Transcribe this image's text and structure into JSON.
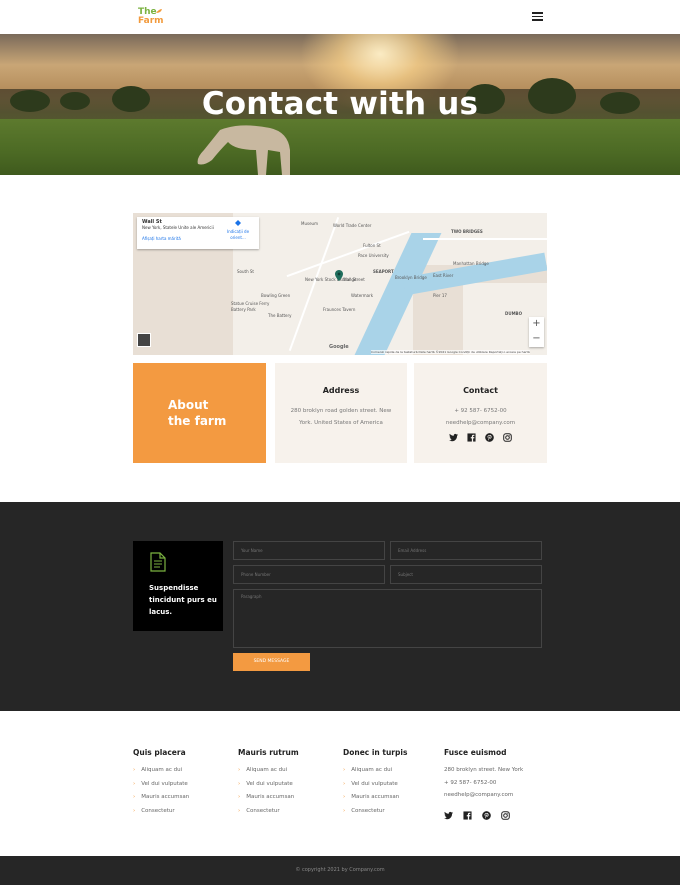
{
  "header": {
    "logo_line1": "The",
    "logo_line2": "Farm"
  },
  "hero": {
    "title": "Contact with us"
  },
  "map": {
    "card_title": "Wall St",
    "card_address": "New York, Statele Unite ale Americii",
    "card_link": "Afișați harta mărită",
    "directions_label": "Indicații de orient...",
    "labels": [
      "Museum",
      "World Trade Center",
      "Fulton St",
      "Pace University",
      "SEAPORT",
      "TWO BRIDGES",
      "Manhattan Bridge",
      "Brooklyn Bridge",
      "East River",
      "Wall Street",
      "New York Stock Exchange",
      "Bowling Green",
      "The Battery",
      "Statue Cruise Ferry",
      "Battery Park",
      "DUMBO",
      "South St",
      "Fraunces Tavern",
      "Watermark",
      "Pier 17"
    ],
    "zoom_in": "+",
    "zoom_out": "−",
    "google": "Google",
    "footer": "Comenzi rapide de la tastatură   Date hartă ©2021 Google   Condiții de utilizare   Raportați o eroare pe hartă"
  },
  "about": {
    "line1": "About",
    "line2": "the farm"
  },
  "address": {
    "heading": "Address",
    "text": "280 broklyn road golden street. New York. United States of America"
  },
  "contact": {
    "heading": "Contact",
    "phone": "+ 92 587- 6752-00",
    "email": "needhelp@company.com"
  },
  "form": {
    "card_text": "Suspendisse tincidunt purs eu lacus.",
    "name_placeholder": "Your Name",
    "email_placeholder": "Email Address",
    "phone_placeholder": "Phone Number",
    "subject_placeholder": "Subject",
    "message_placeholder": "Paragraph",
    "send_label": "SEND MESSAGE"
  },
  "footer": {
    "col1": {
      "heading": "Quis placera",
      "items": [
        "Aliquam ac dui",
        "Vel dui vulputate",
        "Mauris accumsan",
        "Consectetur"
      ]
    },
    "col2": {
      "heading": "Mauris rutrum",
      "items": [
        "Aliquam ac dui",
        "Vel dui vulputate",
        "Mauris accumsan",
        "Consectetur"
      ]
    },
    "col3": {
      "heading": "Donec in turpis",
      "items": [
        "Aliquam ac dui",
        "Vel dui vulputate",
        "Mauris accumsan",
        "Consectetur"
      ]
    },
    "col4": {
      "heading": "Fusce euismod",
      "address": "280 broklyn street. New York",
      "phone": "+ 92 587- 6752-00",
      "email": "needhelp@company.com"
    },
    "bullet": "›",
    "copyright": "© copyright 2021 by Company.com"
  },
  "icons": [
    "menu-icon",
    "twitter-icon",
    "facebook-icon",
    "pinterest-icon",
    "instagram-icon",
    "document-icon",
    "map-pin-icon"
  ],
  "colors": {
    "accent": "#f39a41",
    "brand_green": "#7bb241",
    "dark": "#262626",
    "cream": "#f7f2ec"
  }
}
